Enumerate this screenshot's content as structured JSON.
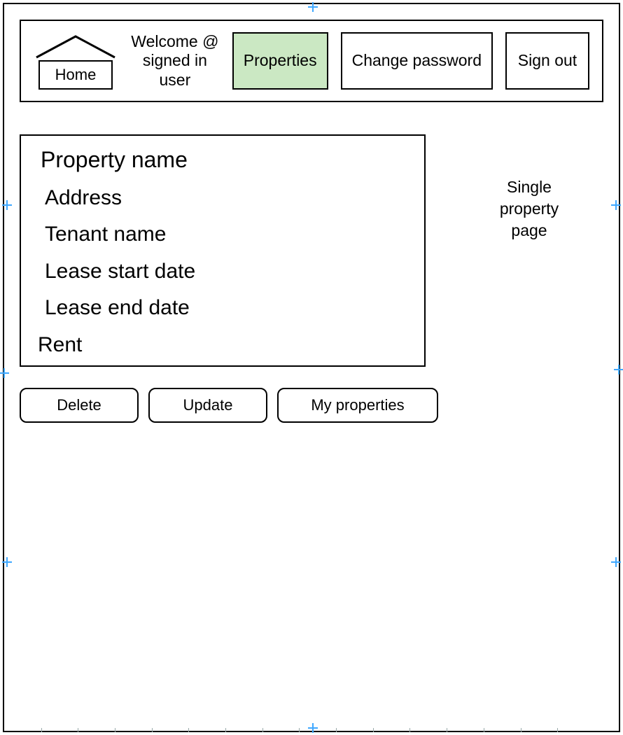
{
  "nav": {
    "home_label": "Home",
    "welcome_line1": "Welcome @",
    "welcome_line2": "signed in user",
    "properties_label": "Properties",
    "change_password_label": "Change password",
    "sign_out_label": "Sign out",
    "active_item": "properties"
  },
  "page_label": {
    "line1": "Single",
    "line2": "property",
    "line3": "page"
  },
  "property": {
    "name_label": "Property name",
    "address_label": "Address",
    "tenant_label": "Tenant name",
    "lease_start_label": "Lease start date",
    "lease_end_label": "Lease end date",
    "rent_label": "Rent"
  },
  "actions": {
    "delete_label": "Delete",
    "update_label": "Update",
    "my_properties_label": "My properties"
  },
  "colors": {
    "active_nav_bg": "#cbe8c3",
    "handle": "#3fa8ff"
  }
}
